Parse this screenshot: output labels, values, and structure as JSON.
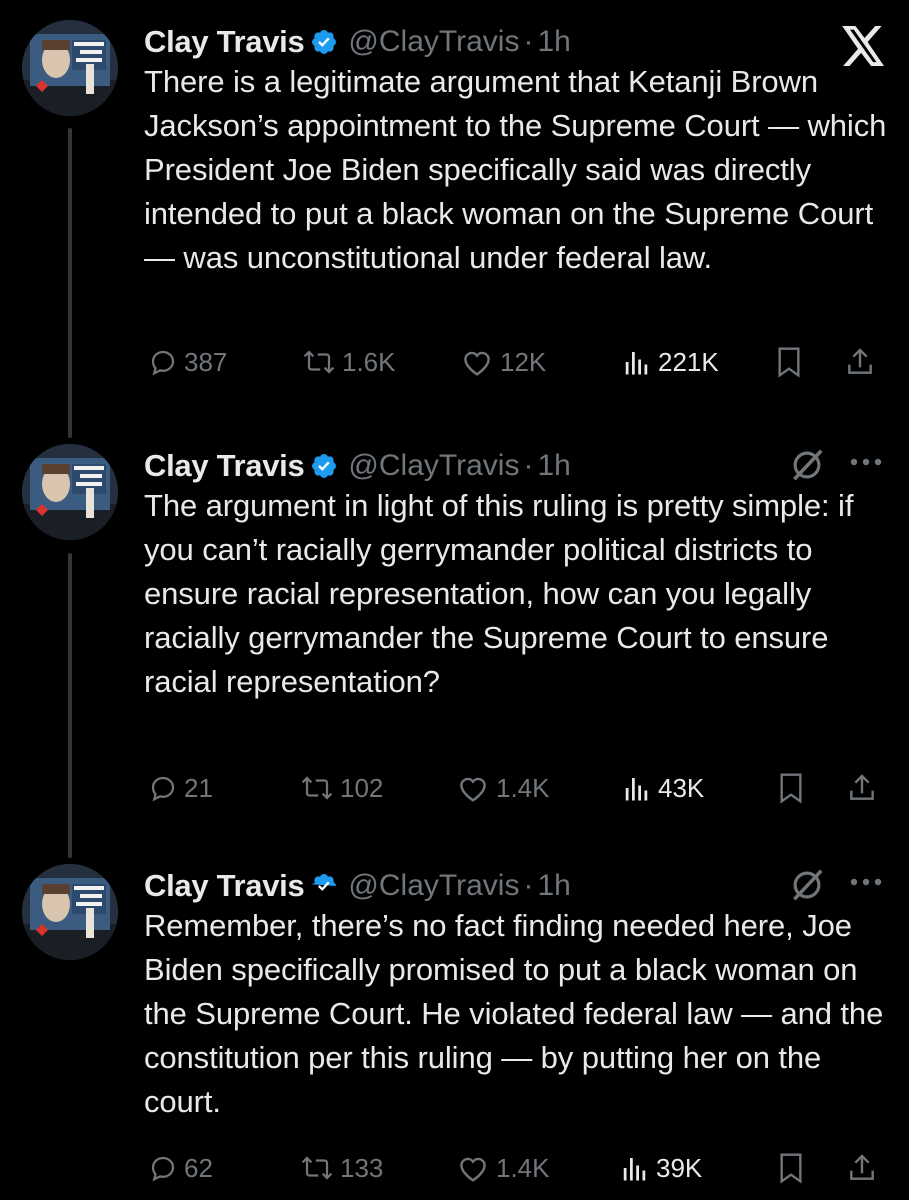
{
  "tweets": [
    {
      "author": {
        "name": "Clay Travis",
        "handle": "@ClayTravis"
      },
      "separator": "·",
      "time": "1h",
      "text": "There is a legitimate argument that Ketanji Brown Jackson’s appointment to the Supreme Court — which President Joe Biden specifically said was directly intended to put a black woman on the Supreme Court — was unconstitutional under federal law.",
      "stats": {
        "replies": "387",
        "reposts": "1.6K",
        "likes": "12K",
        "views": "221K"
      },
      "top_icon": "x-logo-icon"
    },
    {
      "author": {
        "name": "Clay Travis",
        "handle": "@ClayTravis"
      },
      "separator": "·",
      "time": "1h",
      "text": "The argument in light of this ruling is pretty simple: if you can’t racially gerrymander political districts to ensure racial representation, how can you legally racially gerrymander the Supreme Court to ensure racial representation?",
      "stats": {
        "replies": "21",
        "reposts": "102",
        "likes": "1.4K",
        "views": "43K"
      },
      "top_icon": "grok-icon"
    },
    {
      "author": {
        "name": "Clay Travis",
        "handle": "@ClayTravis"
      },
      "separator": "·",
      "time": "1h",
      "text": "Remember, there’s no fact finding needed here, Joe Biden specifically promised to put a black woman on the Supreme Court. He violated federal law — and the constitution per this ruling — by putting her on the court.",
      "stats": {
        "replies": "62",
        "reposts": "133",
        "likes": "1.4K",
        "views": "39K"
      },
      "top_icon": "grok-icon"
    }
  ],
  "colors": {
    "background": "#000000",
    "text": "#e7e9ea",
    "muted": "#71767b",
    "verified": "#1d9bf0",
    "thread_line": "#333639"
  }
}
